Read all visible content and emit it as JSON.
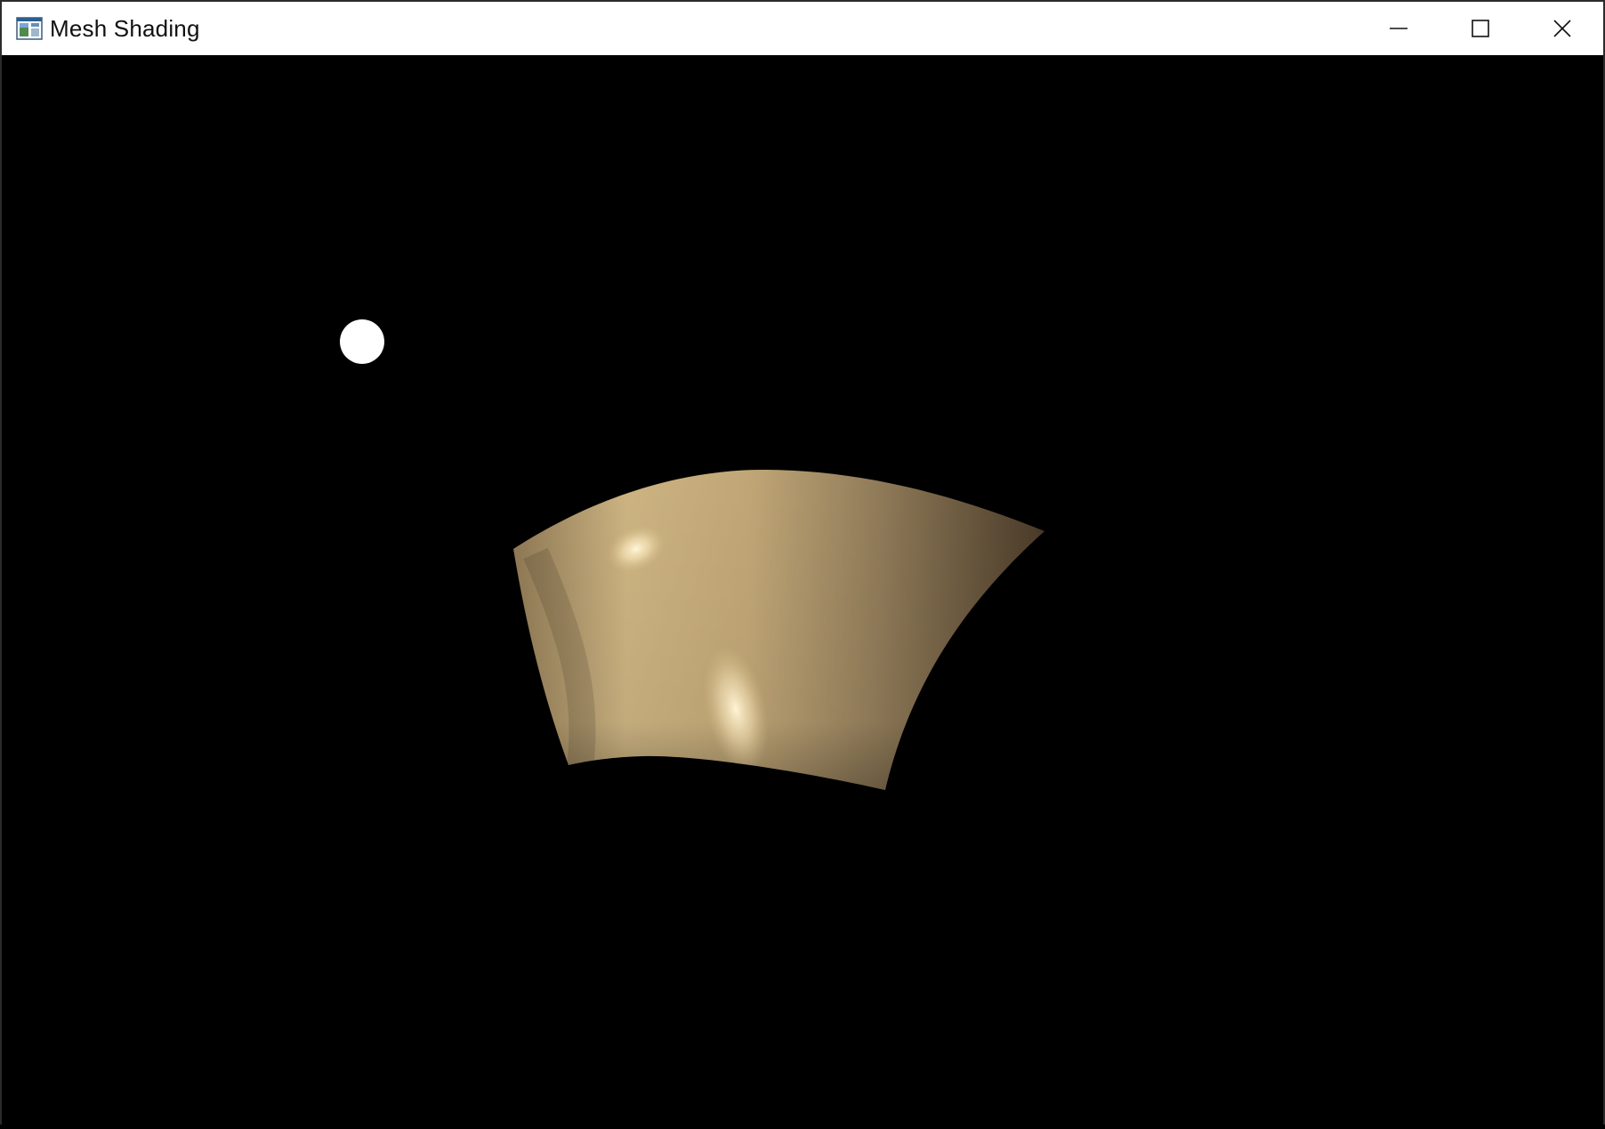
{
  "window": {
    "title": "Mesh Shading",
    "app_icon": "window-app-icon",
    "controls": {
      "minimize_icon": "minimize-icon",
      "maximize_icon": "maximize-icon",
      "close_icon": "close-icon"
    }
  },
  "scene": {
    "background_color": "#000000",
    "light_color": "#ffffff",
    "surface_color": "#c8b07e",
    "surface_shadow_color": "#3e3222",
    "highlight_color": "#fff3d2"
  }
}
